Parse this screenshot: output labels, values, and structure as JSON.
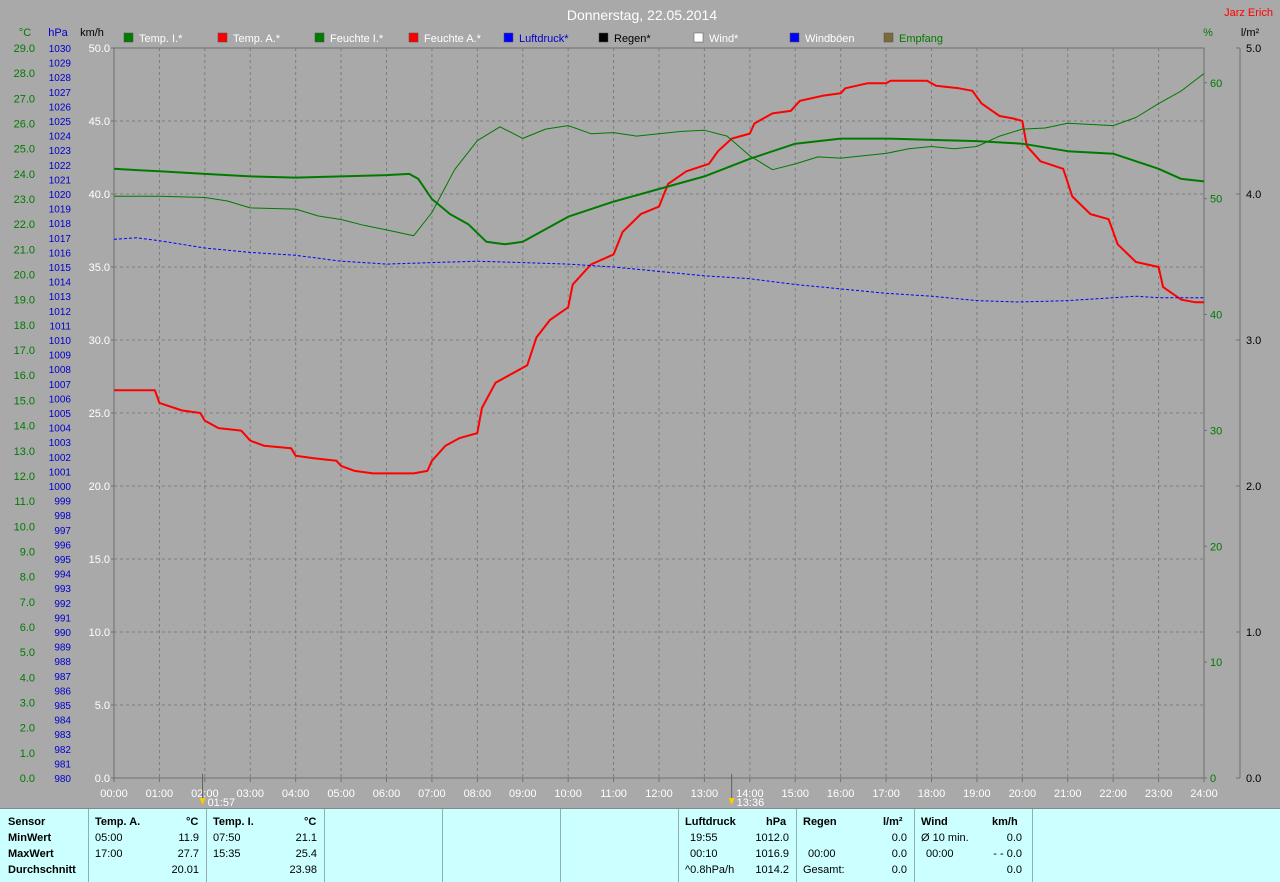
{
  "header": {
    "title": "Donnerstag, 22.05.2014",
    "author": "Jarz Erich"
  },
  "legend": [
    {
      "label": "Temp. I.*",
      "swatch": "#007a00",
      "text_color": "#ffffff"
    },
    {
      "label": "Temp. A.*",
      "swatch": "#ff0000",
      "text_color": "#ffffff"
    },
    {
      "label": "Feuchte I.*",
      "swatch": "#007a00",
      "text_color": "#ffffff"
    },
    {
      "label": "Feuchte A.*",
      "swatch": "#ff0000",
      "text_color": "#ffffff"
    },
    {
      "label": "Luftdruck*",
      "swatch": "#0000ff",
      "text_color": "#0000cc"
    },
    {
      "label": "Regen*",
      "swatch": "#000000",
      "text_color": "#000000"
    },
    {
      "label": "Wind*",
      "swatch": "#ffffff",
      "text_color": "#ffffff"
    },
    {
      "label": "Windböen",
      "swatch": "#0000ff",
      "text_color": "#ffffff"
    },
    {
      "label": "Empfang",
      "swatch": "#7a6b3a",
      "text_color": "#007a00"
    }
  ],
  "axis_units": {
    "celsius": "°C",
    "hpa": "hPa",
    "kmh": "km/h",
    "percent": "%",
    "rain": "l/m²"
  },
  "markers": [
    {
      "time": "01:57",
      "hour": 1.95
    },
    {
      "time": "13:36",
      "hour": 13.6
    }
  ],
  "chart_data": {
    "type": "line",
    "title": "Donnerstag, 22.05.2014",
    "x_ticks": [
      "00:00",
      "01:00",
      "02:00",
      "03:00",
      "04:00",
      "05:00",
      "06:00",
      "07:00",
      "08:00",
      "09:00",
      "10:00",
      "11:00",
      "12:00",
      "13:00",
      "14:00",
      "15:00",
      "16:00",
      "17:00",
      "18:00",
      "19:00",
      "20:00",
      "21:00",
      "22:00",
      "23:00",
      "24:00"
    ],
    "xlim": [
      0,
      24
    ],
    "axes": {
      "temperature_c": {
        "range": [
          0,
          29
        ],
        "step": 1
      },
      "pressure_hpa": {
        "range": [
          980,
          1030
        ],
        "step": 1
      },
      "wind_kmh": {
        "range": [
          0,
          50
        ],
        "step": 5
      },
      "humidity_pct": {
        "range": [
          0,
          63
        ],
        "ticks": [
          0,
          10,
          20,
          30,
          40,
          50,
          60
        ]
      },
      "rain_lm2": {
        "range": [
          0,
          5
        ],
        "ticks": [
          0,
          1,
          2,
          3,
          4,
          5
        ]
      }
    },
    "grid": true,
    "series": [
      {
        "name": "Temp. A.",
        "axis": "temperature_c",
        "color": "#ff0000",
        "width": 2,
        "points": [
          [
            0,
            15.4
          ],
          [
            0.9,
            15.4
          ],
          [
            1,
            14.9
          ],
          [
            1.5,
            14.6
          ],
          [
            1.9,
            14.5
          ],
          [
            2,
            14.2
          ],
          [
            2.3,
            13.9
          ],
          [
            2.8,
            13.8
          ],
          [
            3,
            13.4
          ],
          [
            3.3,
            13.2
          ],
          [
            3.9,
            13.1
          ],
          [
            4,
            12.8
          ],
          [
            4.4,
            12.7
          ],
          [
            4.9,
            12.6
          ],
          [
            5,
            12.4
          ],
          [
            5.3,
            12.2
          ],
          [
            5.7,
            12.1
          ],
          [
            6.2,
            12.1
          ],
          [
            6.6,
            12.1
          ],
          [
            6.9,
            12.2
          ],
          [
            7,
            12.6
          ],
          [
            7.3,
            13.2
          ],
          [
            7.6,
            13.5
          ],
          [
            8,
            13.7
          ],
          [
            8.1,
            14.7
          ],
          [
            8.4,
            15.7
          ],
          [
            8.8,
            16.1
          ],
          [
            9.1,
            16.4
          ],
          [
            9.3,
            17.5
          ],
          [
            9.6,
            18.2
          ],
          [
            10,
            18.7
          ],
          [
            10.1,
            19.6
          ],
          [
            10.5,
            20.4
          ],
          [
            11,
            20.8
          ],
          [
            11.2,
            21.7
          ],
          [
            11.6,
            22.4
          ],
          [
            12,
            22.7
          ],
          [
            12.2,
            23.6
          ],
          [
            12.6,
            24.1
          ],
          [
            13.1,
            24.4
          ],
          [
            13.3,
            24.9
          ],
          [
            13.6,
            25.4
          ],
          [
            14,
            25.6
          ],
          [
            14.1,
            26.0
          ],
          [
            14.5,
            26.4
          ],
          [
            14.9,
            26.5
          ],
          [
            15.1,
            26.9
          ],
          [
            15.6,
            27.1
          ],
          [
            16,
            27.2
          ],
          [
            16.1,
            27.4
          ],
          [
            16.6,
            27.6
          ],
          [
            17,
            27.6
          ],
          [
            17.1,
            27.7
          ],
          [
            17.6,
            27.7
          ],
          [
            17.9,
            27.7
          ],
          [
            18.1,
            27.5
          ],
          [
            18.6,
            27.4
          ],
          [
            18.9,
            27.3
          ],
          [
            19.1,
            26.8
          ],
          [
            19.5,
            26.3
          ],
          [
            19.8,
            26.2
          ],
          [
            20,
            26.1
          ],
          [
            20.1,
            25.1
          ],
          [
            20.4,
            24.5
          ],
          [
            20.9,
            24.2
          ],
          [
            21.1,
            23.1
          ],
          [
            21.5,
            22.4
          ],
          [
            21.9,
            22.2
          ],
          [
            22.1,
            21.2
          ],
          [
            22.5,
            20.5
          ],
          [
            23,
            20.3
          ],
          [
            23.1,
            19.5
          ],
          [
            23.5,
            19.0
          ],
          [
            23.8,
            18.9
          ],
          [
            24,
            18.9
          ]
        ]
      },
      {
        "name": "Temp. I.",
        "axis": "temperature_c",
        "color": "#007a00",
        "width": 2,
        "points": [
          [
            0,
            24.2
          ],
          [
            0.5,
            24.15
          ],
          [
            1,
            24.1
          ],
          [
            2,
            24.0
          ],
          [
            3,
            23.9
          ],
          [
            4,
            23.85
          ],
          [
            5,
            23.9
          ],
          [
            6,
            23.95
          ],
          [
            6.5,
            24.0
          ],
          [
            6.7,
            23.8
          ],
          [
            7,
            23.0
          ],
          [
            7.4,
            22.4
          ],
          [
            7.8,
            22.0
          ],
          [
            8.2,
            21.3
          ],
          [
            8.6,
            21.2
          ],
          [
            9,
            21.3
          ],
          [
            9.5,
            21.8
          ],
          [
            10,
            22.3
          ],
          [
            11,
            22.9
          ],
          [
            12,
            23.4
          ],
          [
            13,
            23.9
          ],
          [
            14,
            24.6
          ],
          [
            15,
            25.2
          ],
          [
            16,
            25.4
          ],
          [
            17,
            25.4
          ],
          [
            18,
            25.35
          ],
          [
            19,
            25.3
          ],
          [
            20,
            25.2
          ],
          [
            21,
            24.9
          ],
          [
            22,
            24.8
          ],
          [
            23,
            24.2
          ],
          [
            23.5,
            23.8
          ],
          [
            24,
            23.7
          ]
        ]
      },
      {
        "name": "Feuchte I.",
        "axis": "humidity_pct",
        "color": "#007a00",
        "width": 1,
        "points": [
          [
            0,
            50.2
          ],
          [
            1,
            50.2
          ],
          [
            2,
            50.1
          ],
          [
            2.5,
            49.8
          ],
          [
            3,
            49.2
          ],
          [
            4,
            49.1
          ],
          [
            4.5,
            48.5
          ],
          [
            5,
            48.2
          ],
          [
            5.5,
            47.7
          ],
          [
            6,
            47.3
          ],
          [
            6.6,
            46.8
          ],
          [
            7,
            48.8
          ],
          [
            7.5,
            52.5
          ],
          [
            8,
            55.0
          ],
          [
            8.5,
            56.2
          ],
          [
            9,
            55.2
          ],
          [
            9.5,
            56.0
          ],
          [
            10,
            56.3
          ],
          [
            10.5,
            55.6
          ],
          [
            11,
            55.7
          ],
          [
            11.5,
            55.4
          ],
          [
            12,
            55.6
          ],
          [
            12.5,
            55.8
          ],
          [
            13,
            55.9
          ],
          [
            13.5,
            55.4
          ],
          [
            14,
            53.7
          ],
          [
            14.5,
            52.5
          ],
          [
            15,
            53.0
          ],
          [
            15.5,
            53.6
          ],
          [
            16,
            53.5
          ],
          [
            16.5,
            53.7
          ],
          [
            17,
            53.9
          ],
          [
            17.5,
            54.3
          ],
          [
            18,
            54.5
          ],
          [
            18.5,
            54.3
          ],
          [
            19,
            54.5
          ],
          [
            19.5,
            55.4
          ],
          [
            20,
            56.0
          ],
          [
            20.5,
            56.1
          ],
          [
            21,
            56.5
          ],
          [
            22,
            56.3
          ],
          [
            22.5,
            57.0
          ],
          [
            23,
            58.2
          ],
          [
            23.5,
            59.3
          ],
          [
            24,
            60.8
          ]
        ]
      },
      {
        "name": "Luftdruck",
        "axis": "pressure_hpa",
        "color": "#0000ff",
        "width": 1,
        "dashed": true,
        "points": [
          [
            0,
            1016.9
          ],
          [
            0.5,
            1017.0
          ],
          [
            1,
            1016.8
          ],
          [
            2,
            1016.3
          ],
          [
            3,
            1016.0
          ],
          [
            4,
            1015.8
          ],
          [
            5,
            1015.4
          ],
          [
            5.5,
            1015.3
          ],
          [
            6,
            1015.2
          ],
          [
            7,
            1015.3
          ],
          [
            8,
            1015.4
          ],
          [
            9,
            1015.3
          ],
          [
            10,
            1015.2
          ],
          [
            11,
            1015.0
          ],
          [
            12,
            1014.7
          ],
          [
            13,
            1014.4
          ],
          [
            14,
            1014.2
          ],
          [
            15,
            1013.8
          ],
          [
            16,
            1013.5
          ],
          [
            17,
            1013.2
          ],
          [
            18,
            1013.0
          ],
          [
            19,
            1012.7
          ],
          [
            19.9,
            1012.6
          ],
          [
            20.5,
            1012.65
          ],
          [
            21,
            1012.7
          ],
          [
            22,
            1012.9
          ],
          [
            22.5,
            1013.0
          ],
          [
            23,
            1012.9
          ],
          [
            24,
            1012.9
          ]
        ]
      }
    ]
  },
  "summary": {
    "rows": [
      "Sensor",
      "MinWert",
      "MaxWert",
      "Durchschnitt"
    ],
    "temp_a": {
      "header": "Temp. A.",
      "unit": "°C",
      "min_time": "05:00",
      "min": "11.9",
      "max_time": "17:00",
      "max": "27.7",
      "avg": "20.01"
    },
    "temp_i": {
      "header": "Temp. I.",
      "unit": "°C",
      "min_time": "07:50",
      "min": "21.1",
      "max_time": "15:35",
      "max": "25.4",
      "avg": "23.98"
    },
    "pressure": {
      "header": "Luftdruck",
      "unit": "hPa",
      "t1": "19:55",
      "v1": "1012.0",
      "t2": "00:10",
      "v2": "1016.9",
      "t3": "^0.8hPa/h",
      "v3": "1014.2"
    },
    "rain": {
      "header": "Regen",
      "unit": "l/m²",
      "t2": "00:00",
      "v1": "0.0",
      "v2": "0.0",
      "t3": "Gesamt:",
      "v3": "0.0"
    },
    "wind": {
      "header": "Wind",
      "unit": "km/h",
      "t1": "Ø 10 min.",
      "v1": "0.0",
      "t2": "00:00",
      "v2": "- - 0.0",
      "v3": "0.0"
    }
  }
}
